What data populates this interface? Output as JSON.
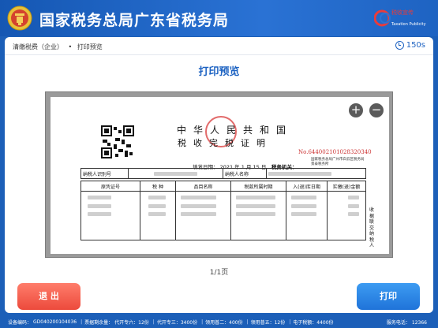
{
  "header": {
    "title": "国家税务总局广东省税务局",
    "logo_text": "税收宣传",
    "logo_sub": "Taxation Publicity"
  },
  "breadcrumb": {
    "item1": "清缴税费（企业）",
    "item2": "打印预览"
  },
  "timer": {
    "value": "150s"
  },
  "page_title": "打印预览",
  "certificate": {
    "title": "中华人民共和国",
    "subtitle": "税收完税证明",
    "number": "No.644002101028320340",
    "org": "国家税务总局广州市白云区税务局景泰税务所",
    "fill_date": "填发日期：  2021  年   1   月   15   日",
    "tax_office": "税务机关：",
    "row1": {
      "label1": "纳税人识别号",
      "label2": "纳税人名称"
    },
    "columns": [
      "原凭证号",
      "税  种",
      "品目名称",
      "税款所属时期",
      "入(退)库日期",
      "实缴(退)金额"
    ],
    "side_note": "收据联 交纳税人"
  },
  "pager": "1/1页",
  "buttons": {
    "exit": "退 出",
    "print": "打印"
  },
  "footer": {
    "device_label": "设备编码：",
    "device_code": "GD040200104036",
    "stock_label": "票据剩余量：",
    "item1": "代开专六：12份",
    "item2": "代开专三：3400份",
    "item3": "领用普二：400份",
    "item4": "领用普五：12份",
    "item5": "电子税额：4400份",
    "phone_label": "服务电话：",
    "phone": "12366"
  },
  "colors": {
    "brand_blue": "#1e63c2",
    "exit_red": "#ec4a3c",
    "stamp_red": "#d83a3a"
  }
}
